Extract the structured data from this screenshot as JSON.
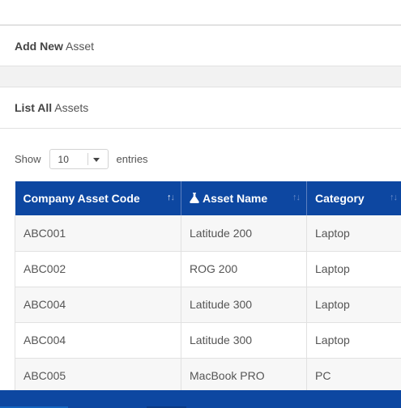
{
  "panels": {
    "add": {
      "bold": "Add New",
      "rest": "Asset"
    },
    "list": {
      "bold": "List All",
      "rest": "Assets"
    }
  },
  "length_control": {
    "show_label": "Show",
    "selected": "10",
    "entries_label": "entries"
  },
  "table": {
    "columns": [
      {
        "label": "Company Asset Code",
        "sort": "ascending"
      },
      {
        "label": "Asset Name",
        "sort": "none",
        "icon": "flask-icon"
      },
      {
        "label": "Category",
        "sort": "none"
      }
    ],
    "rows": [
      [
        "ABC001",
        "Latitude 200",
        "Laptop"
      ],
      [
        "ABC002",
        "ROG 200",
        "Laptop"
      ],
      [
        "ABC004",
        "Latitude 300",
        "Laptop"
      ],
      [
        "ABC004",
        "Latitude 300",
        "Laptop"
      ],
      [
        "ABC005",
        "MacBook PRO",
        "PC"
      ]
    ]
  },
  "colors": {
    "header_bg": "#0d47a1",
    "footer_bg": "#0d47a1",
    "row_stripe": "#f7f7f7"
  }
}
